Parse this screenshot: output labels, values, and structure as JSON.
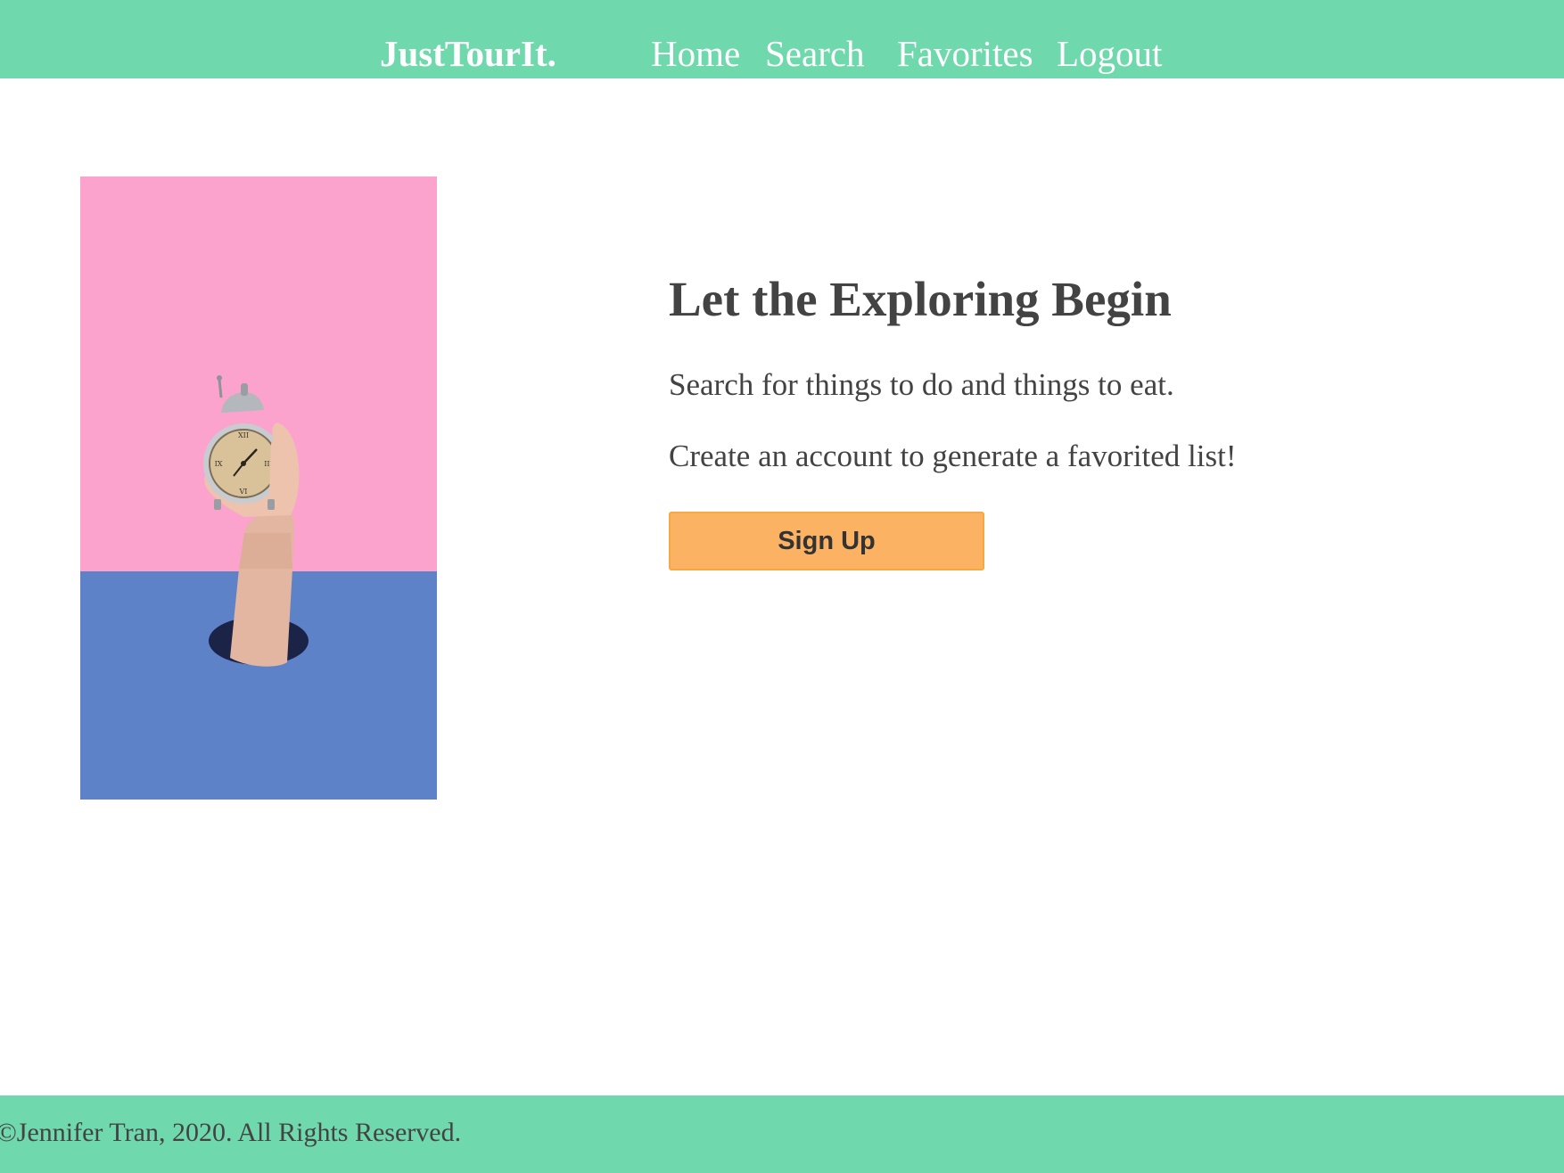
{
  "navbar": {
    "brand": "JustTourIt.",
    "links": [
      "Home",
      "Search",
      "Favorites",
      "Logout"
    ]
  },
  "hero": {
    "title": "Let the Exploring Begin",
    "line1": "Search for things to do and things to eat.",
    "line2": "Create an account to generate a favorited list!",
    "button_label": "Sign Up",
    "image_icon": "hand-holding-alarm-clock-illustration"
  },
  "footer": {
    "copyright": "©Jennifer Tran, 2020. All Rights Reserved."
  },
  "colors": {
    "nav_footer_bg": "#6fd8ac",
    "button_bg": "#fbb262",
    "image_top": "#fba3cd",
    "image_bottom": "#5d82c8",
    "text": "#434343"
  }
}
